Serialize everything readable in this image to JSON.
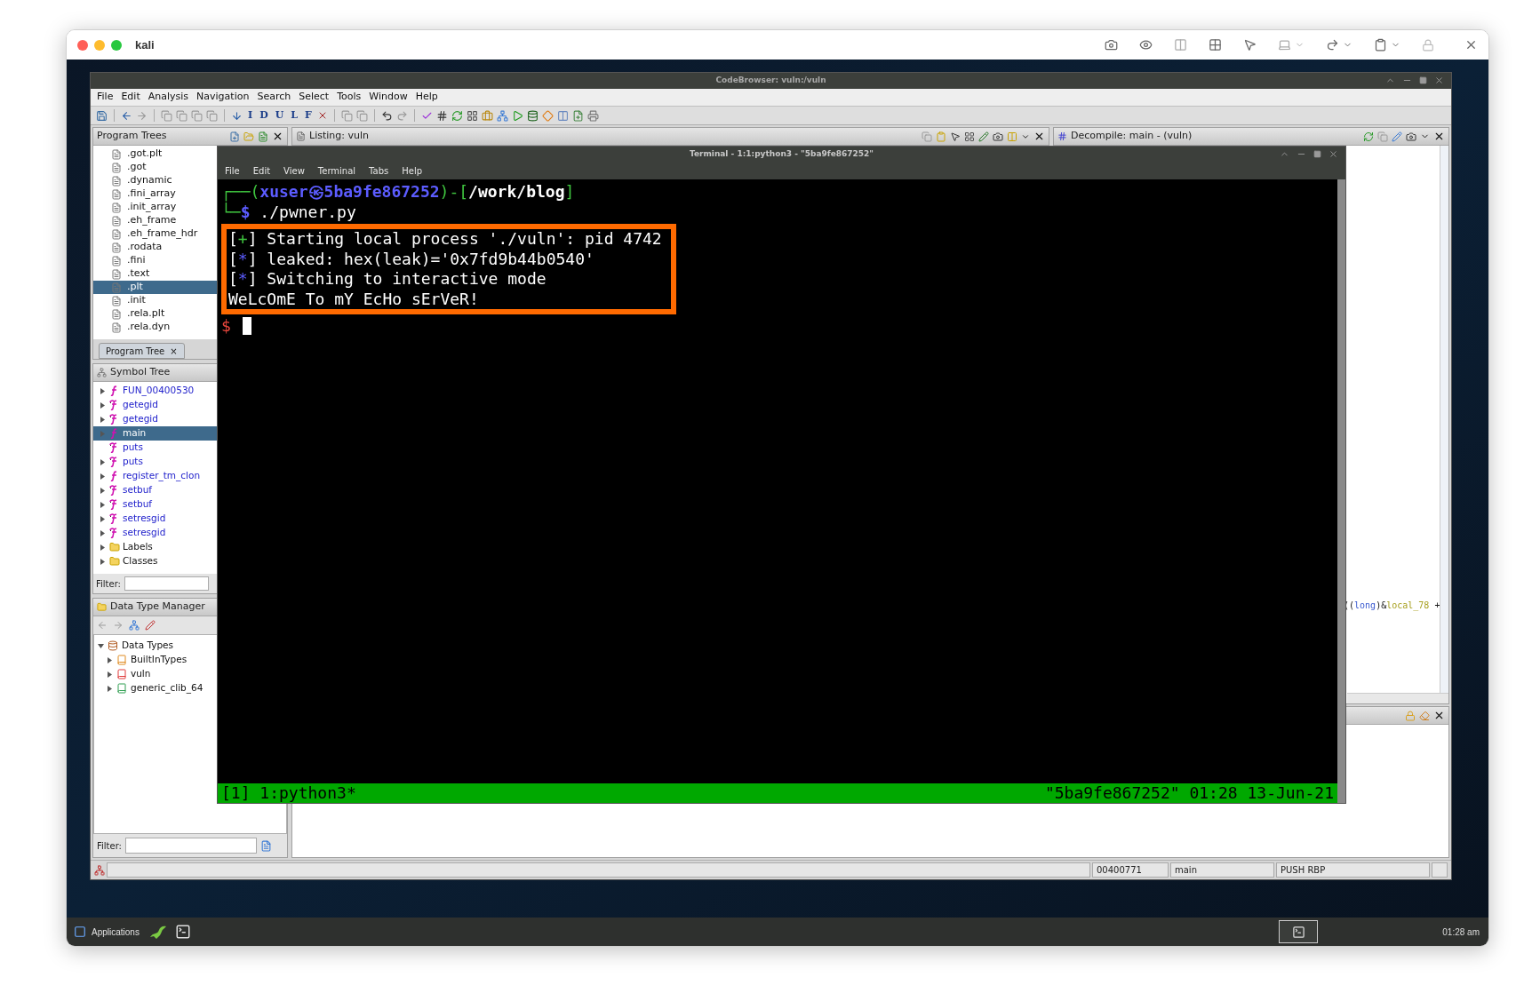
{
  "host_window": {
    "title": "kali"
  },
  "ghidra": {
    "title": "CodeBrowser: vuln:/vuln",
    "menu": [
      "File",
      "Edit",
      "Analysis",
      "Navigation",
      "Search",
      "Select",
      "Tools",
      "Window",
      "Help"
    ],
    "toolbar_letters": [
      "I",
      "D",
      "U",
      "L",
      "F"
    ],
    "program_trees": {
      "title": "Program Trees",
      "items": [
        {
          "label": ".got.plt",
          "selected": false
        },
        {
          "label": ".got",
          "selected": false
        },
        {
          "label": ".dynamic",
          "selected": false
        },
        {
          "label": ".fini_array",
          "selected": false
        },
        {
          "label": ".init_array",
          "selected": false
        },
        {
          "label": ".eh_frame",
          "selected": false
        },
        {
          "label": ".eh_frame_hdr",
          "selected": false
        },
        {
          "label": ".rodata",
          "selected": false
        },
        {
          "label": ".fini",
          "selected": false
        },
        {
          "label": ".text",
          "selected": false
        },
        {
          "label": ".plt",
          "selected": true
        },
        {
          "label": ".init",
          "selected": false
        },
        {
          "label": ".rela.plt",
          "selected": false
        },
        {
          "label": ".rela.dyn",
          "selected": false
        }
      ],
      "tab": {
        "label": "Program Tree",
        "close": "×"
      }
    },
    "listing": {
      "title": "Listing:  vuln"
    },
    "decompile": {
      "title": "Decompile: main -  (vuln)",
      "code": [
        {
          "text": "((",
          "kind": "plain"
        },
        {
          "text": "long",
          "kind": "type"
        },
        {
          "text": ")&",
          "kind": "plain"
        },
        {
          "text": "local_78",
          "kind": "variable"
        },
        {
          "text": " +",
          "kind": "plain"
        }
      ]
    },
    "symbol_tree": {
      "title": "Symbol Tree",
      "items": [
        {
          "label": "FUN_00400530",
          "kind": "function",
          "expandable": true,
          "selected": false
        },
        {
          "label": "getegid",
          "kind": "external",
          "expandable": true,
          "selected": false
        },
        {
          "label": "getegid",
          "kind": "external",
          "expandable": true,
          "selected": false
        },
        {
          "label": "main",
          "kind": "function",
          "expandable": true,
          "selected": true
        },
        {
          "label": "puts",
          "kind": "external",
          "expandable": false,
          "selected": false
        },
        {
          "label": "puts",
          "kind": "external",
          "expandable": true,
          "selected": false
        },
        {
          "label": "register_tm_clon",
          "kind": "function",
          "expandable": true,
          "selected": false
        },
        {
          "label": "setbuf",
          "kind": "external",
          "expandable": true,
          "selected": false
        },
        {
          "label": "setbuf",
          "kind": "external",
          "expandable": true,
          "selected": false
        },
        {
          "label": "setresgid",
          "kind": "external",
          "expandable": true,
          "selected": false
        },
        {
          "label": "setresgid",
          "kind": "external",
          "expandable": true,
          "selected": false
        },
        {
          "label": "Labels",
          "kind": "folder",
          "expandable": true,
          "selected": false
        },
        {
          "label": "Classes",
          "kind": "folder",
          "expandable": true,
          "selected": false
        }
      ],
      "filter_label": "Filter:"
    },
    "data_type_manager": {
      "title": "Data Type Manager",
      "root": {
        "label": "Data Types",
        "expanded": true,
        "children": [
          {
            "label": "BuiltInTypes",
            "kind": "builtin",
            "expanded": false
          },
          {
            "label": "vuln",
            "kind": "program",
            "expanded": false
          },
          {
            "label": "generic_clib_64",
            "kind": "archive",
            "expanded": false
          }
        ]
      },
      "filter_label": "Filter:"
    },
    "status_bar": [
      "00400771",
      "main",
      "PUSH RBP"
    ]
  },
  "terminal": {
    "title": "Terminal - 1:1:python3 - \"5ba9fe867252\"",
    "menu": [
      "File",
      "Edit",
      "View",
      "Terminal",
      "Tabs",
      "Help"
    ],
    "lines": [
      {
        "highlighted": false,
        "cursor": false,
        "segments": [
          {
            "text": "┌──(",
            "color": "#3fc43f"
          },
          {
            "text": "xuser㉿5ba9fe867252",
            "color": "#5c5cff",
            "bold": true
          },
          {
            "text": ")-[",
            "color": "#3fc43f"
          },
          {
            "text": "/work/blog",
            "color": "#ffffff",
            "bold": true
          },
          {
            "text": "]",
            "color": "#3fc43f"
          }
        ]
      },
      {
        "highlighted": false,
        "cursor": false,
        "segments": [
          {
            "text": "└─",
            "color": "#3fc43f"
          },
          {
            "text": "$",
            "color": "#5c5cff",
            "bold": true
          },
          {
            "text": " ./pwner.py",
            "color": "#ffffff"
          }
        ]
      },
      {
        "highlighted": true,
        "cursor": false,
        "segments": [
          {
            "text": "[",
            "color": "#ffffff"
          },
          {
            "text": "+",
            "color": "#3fc43f"
          },
          {
            "text": "] Starting local process './vuln': pid 4742",
            "color": "#ffffff"
          }
        ]
      },
      {
        "highlighted": true,
        "cursor": false,
        "segments": [
          {
            "text": "[",
            "color": "#ffffff"
          },
          {
            "text": "*",
            "color": "#5c5cff"
          },
          {
            "text": "] leaked: hex(leak)='0x7fd9b44b0540'",
            "color": "#ffffff"
          }
        ]
      },
      {
        "highlighted": true,
        "cursor": false,
        "segments": [
          {
            "text": "[",
            "color": "#ffffff"
          },
          {
            "text": "*",
            "color": "#5c5cff"
          },
          {
            "text": "] Switching to interactive mode",
            "color": "#ffffff"
          }
        ]
      },
      {
        "highlighted": true,
        "cursor": false,
        "segments": [
          {
            "text": "WeLcOmE To mY EcHo sErVeR!",
            "color": "#ffffff"
          }
        ]
      },
      {
        "highlighted": false,
        "cursor": true,
        "segments": [
          {
            "text": "$",
            "color": "#e8463c"
          }
        ]
      }
    ],
    "status_left": "[1] 1:python3*",
    "status_right": "\"5ba9fe867252\" 01:28 13-Jun-21"
  },
  "taskbar": {
    "apps_label": "Applications",
    "clock": "01:28 am"
  }
}
